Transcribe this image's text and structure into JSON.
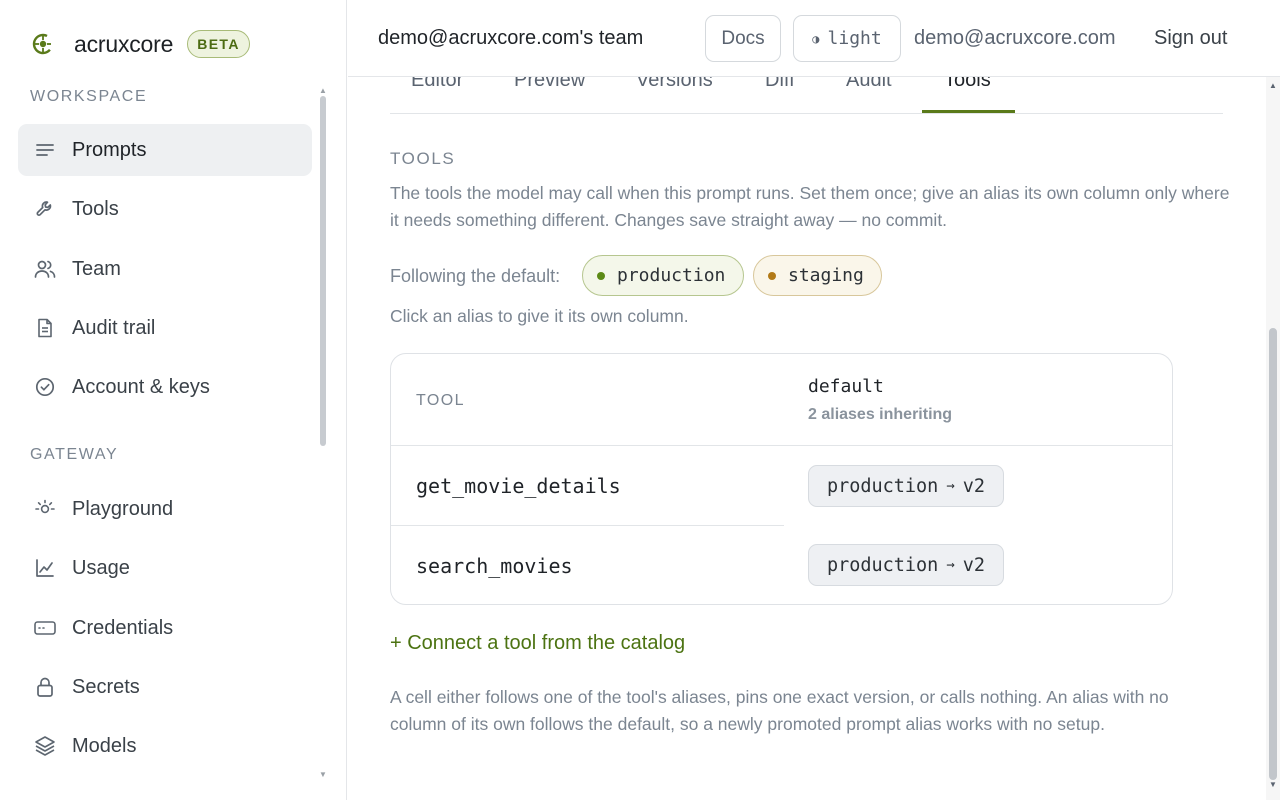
{
  "brand": {
    "name": "acruxcore",
    "badge": "BETA",
    "accent": "#5a7a1a"
  },
  "sidebar": {
    "sections": [
      {
        "label": "WORKSPACE"
      },
      {
        "label": "GATEWAY"
      }
    ],
    "items": [
      {
        "label": "Prompts",
        "icon": "list-icon",
        "active": true
      },
      {
        "label": "Tools",
        "icon": "wrench-icon"
      },
      {
        "label": "Team",
        "icon": "users-icon"
      },
      {
        "label": "Audit trail",
        "icon": "document-icon"
      },
      {
        "label": "Account & keys",
        "icon": "check-circle-icon"
      },
      {
        "label": "Playground",
        "icon": "sun-icon"
      },
      {
        "label": "Usage",
        "icon": "chart-line-icon"
      },
      {
        "label": "Credentials",
        "icon": "card-icon"
      },
      {
        "label": "Secrets",
        "icon": "lock-icon"
      },
      {
        "label": "Models",
        "icon": "layers-icon"
      }
    ]
  },
  "header": {
    "team": "demo@acruxcore.com's team",
    "docs_label": "Docs",
    "theme_label": "light",
    "email": "demo@acruxcore.com",
    "signout_label": "Sign out"
  },
  "tabs": [
    {
      "label": "Editor"
    },
    {
      "label": "Preview"
    },
    {
      "label": "Versions"
    },
    {
      "label": "Diff"
    },
    {
      "label": "Audit"
    },
    {
      "label": "Tools",
      "active": true
    }
  ],
  "tools": {
    "heading": "TOOLS",
    "description": "The tools the model may call when this prompt runs. Set them once; give an alias its own column only where it needs something different. Changes save straight away — no commit.",
    "following_label": "Following the default:",
    "aliases": [
      {
        "name": "production",
        "color": "#5c8a16"
      },
      {
        "name": "staging",
        "color": "#b27a17"
      }
    ],
    "hint": "Click an alias to give it its own column.",
    "table": {
      "col_tool": "TOOL",
      "col_default": "default",
      "col_default_sub": "2 aliases inheriting",
      "rows": [
        {
          "tool": "get_movie_details",
          "alias": "production",
          "arrow": "→",
          "version": "v2"
        },
        {
          "tool": "search_movies",
          "alias": "production",
          "arrow": "→",
          "version": "v2"
        }
      ]
    },
    "connect_label": "+ Connect a tool from the catalog",
    "footnote": "A cell either follows one of the tool's aliases, pins one exact version, or calls nothing. An alias with no column of its own follows the default, so a newly promoted prompt alias works with no setup."
  }
}
